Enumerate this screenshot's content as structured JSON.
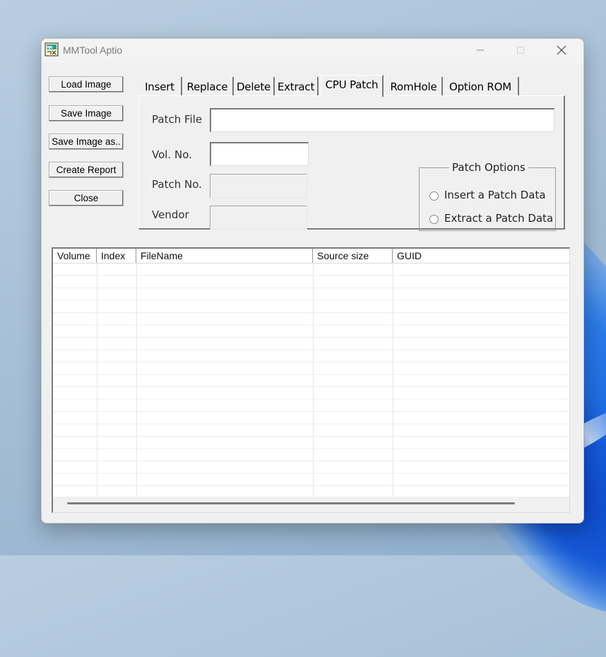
{
  "window": {
    "title": "MMTool Aptio"
  },
  "buttons": {
    "load_image": "Load Image",
    "save_image": "Save Image",
    "save_image_as": "Save Image as..",
    "create_report": "Create Report",
    "close": "Close"
  },
  "tabs": [
    {
      "label": "Insert"
    },
    {
      "label": "Replace"
    },
    {
      "label": "Delete"
    },
    {
      "label": "Extract"
    },
    {
      "label": "CPU Patch",
      "active": true
    },
    {
      "label": "RomHole"
    },
    {
      "label": "Option ROM"
    }
  ],
  "cpu_patch": {
    "patch_file_label": "Patch File",
    "patch_file_value": "",
    "vol_no_label": "Vol. No.",
    "vol_no_value": "",
    "patch_no_label": "Patch No.",
    "patch_no_value": "",
    "vendor_label": "Vendor",
    "vendor_value": "",
    "patch_options": {
      "title": "Patch Options",
      "insert": "Insert a Patch Data",
      "extract": "Extract a Patch Data"
    }
  },
  "table": {
    "columns": [
      "Volume",
      "Index",
      "FileName",
      "Source size",
      "GUID"
    ],
    "rows": []
  }
}
